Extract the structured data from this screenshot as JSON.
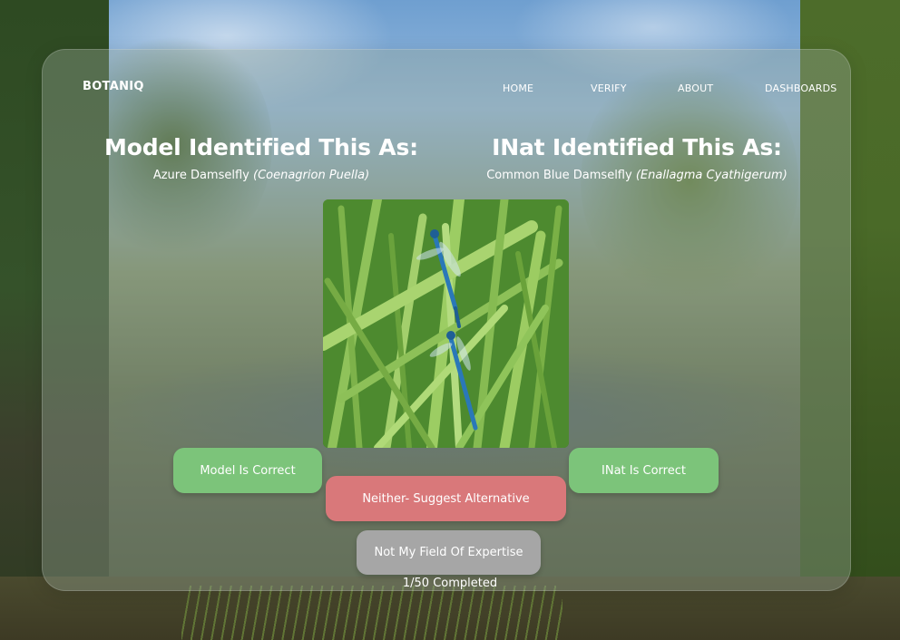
{
  "header": {
    "brand": "BOTANIQ",
    "nav": [
      {
        "label": "HOME"
      },
      {
        "label": "VERIFY"
      },
      {
        "label": "ABOUT"
      },
      {
        "label": "DASHBOARDS"
      }
    ]
  },
  "model": {
    "heading": "Model Identified This As:",
    "common_name": "Azure Damselfly ",
    "scientific_name": "(Coenagrion Puella)"
  },
  "inat": {
    "heading": "INat Identified This As:",
    "common_name": "Common Blue Damselfly ",
    "scientific_name": "(Enallagma Cyathigerum)"
  },
  "actions": {
    "model_correct": "Model Is Correct",
    "inat_correct": "INat Is Correct",
    "neither": "Neither- Suggest Alternative",
    "not_expertise": "Not My Field Of Expertise"
  },
  "progress": {
    "completed": 1,
    "total": 50,
    "text": "1/50 Completed"
  },
  "colors": {
    "confirm_button": "#7cc47a",
    "alternative_button": "#d9787a",
    "skip_button": "#a6a6a6"
  },
  "icons": {
    "specimen_photo": "damselfly-on-grass-photo"
  }
}
